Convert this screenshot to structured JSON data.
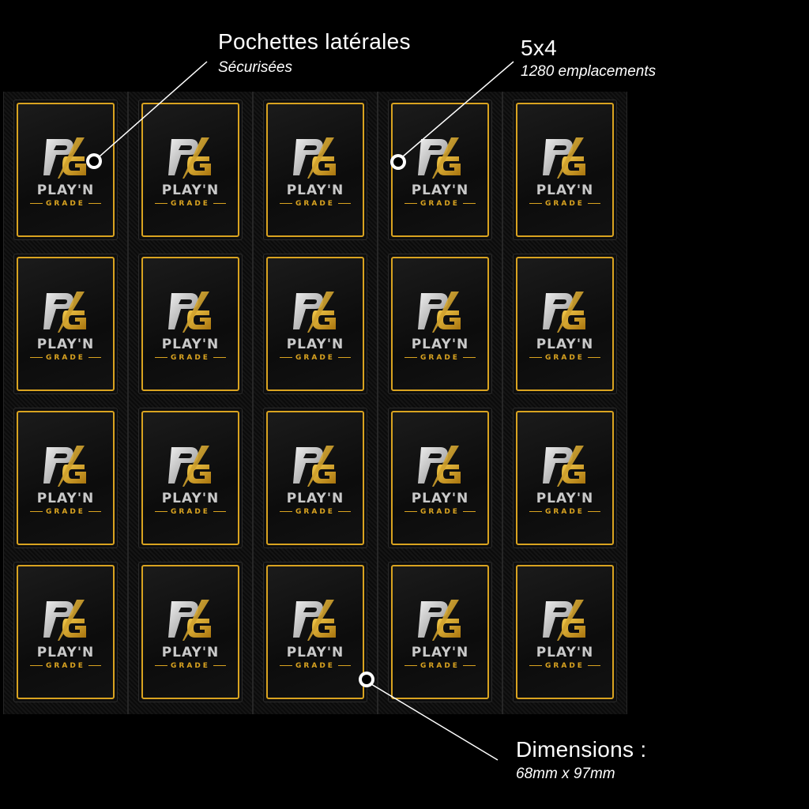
{
  "callouts": {
    "pockets": {
      "title": "Pochettes latérales",
      "subtitle": "Sécurisées"
    },
    "grid": {
      "title": "5x4",
      "subtitle": "1280 emplacements"
    },
    "dimensions": {
      "title": "Dimensions :",
      "subtitle": "68mm x 97mm"
    }
  },
  "card": {
    "brand": "PLAY'N",
    "sub": "GRADE",
    "monogram": "PG"
  },
  "layout": {
    "columns": 5,
    "rows": 4
  },
  "colors": {
    "gold": "#d9a320",
    "silver": "#c9c9c9",
    "background": "#000000"
  }
}
